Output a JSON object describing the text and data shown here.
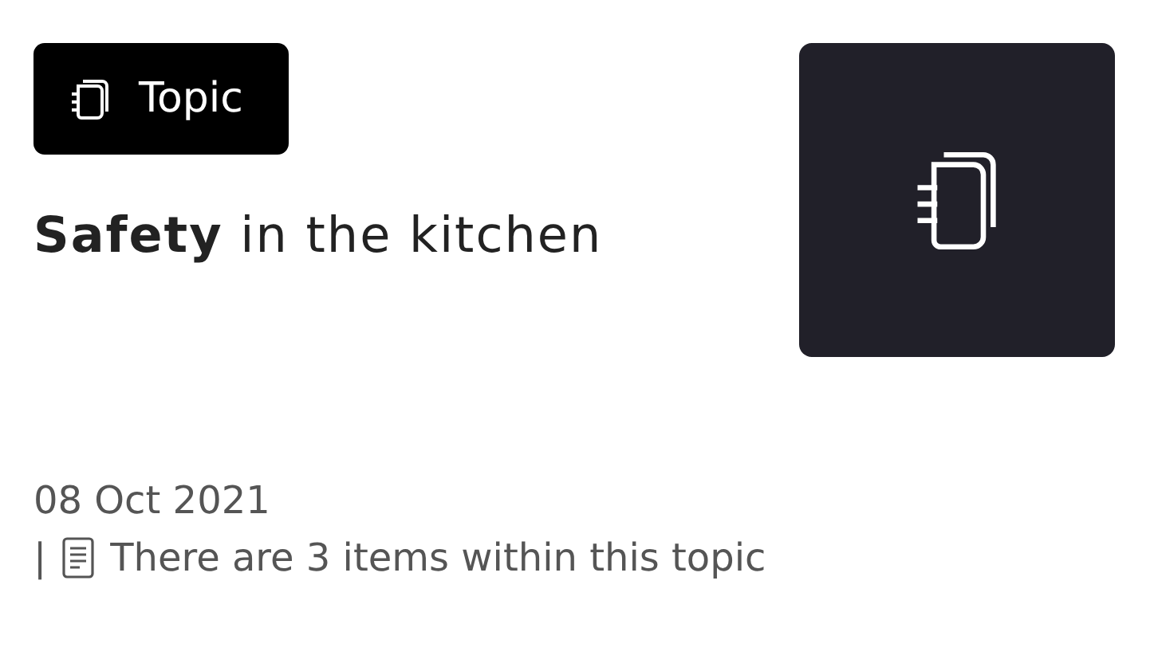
{
  "badge": {
    "label": "Topic"
  },
  "title": "**Safety** in the kitchen",
  "date": "08 Oct 2021",
  "meta": {
    "separator": "|",
    "text": "There are 3 items within this topic"
  }
}
